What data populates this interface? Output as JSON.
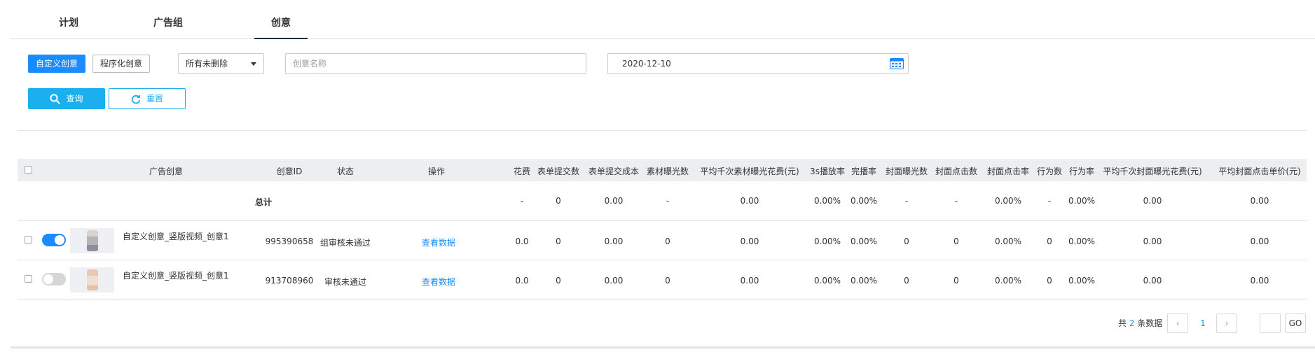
{
  "tabs": [
    "计划",
    "广告组",
    "创意"
  ],
  "filters": {
    "type_custom": "自定义创意",
    "type_program": "程序化创意",
    "status_select": "所有未删除",
    "name_placeholder": "创意名称",
    "date": "2020-12-10",
    "query": "查询",
    "reset": "重置"
  },
  "table": {
    "headers": [
      "广告创意",
      "创意ID",
      "状态",
      "操作",
      "花费",
      "表单提交数",
      "表单提交成本",
      "素材曝光数",
      "平均千次素材曝光花费(元)",
      "3s播放率",
      "完播率",
      "封面曝光数",
      "封面点击数",
      "封面点击率",
      "行为数",
      "行为率",
      "平均千次封面曝光花费(元)",
      "平均封面点击单价(元)"
    ],
    "total": {
      "label": "总计",
      "values": [
        "-",
        "0",
        "0.00",
        "-",
        "0.00",
        "0.00%",
        "0.00%",
        "-",
        "-",
        "0.00%",
        "-",
        "0.00%",
        "0.00",
        "0.00"
      ]
    },
    "rows": [
      {
        "enabled": true,
        "name": "自定义创意_竖版视频_创意1",
        "id": "995390658",
        "status": "组审核未通过",
        "action": "查看数据",
        "values": [
          "0.0",
          "0",
          "0.00",
          "0",
          "0.00",
          "0.00%",
          "0.00%",
          "0",
          "0",
          "0.00%",
          "0",
          "0.00%",
          "0.00",
          "0.00"
        ]
      },
      {
        "enabled": false,
        "name": "自定义创意_竖版视频_创意1",
        "id": "913708960",
        "status": "审核未通过",
        "action": "查看数据",
        "values": [
          "0.0",
          "0",
          "0.00",
          "0",
          "0.00",
          "0.00%",
          "0.00%",
          "0",
          "0",
          "0.00%",
          "0",
          "0.00%",
          "0.00",
          "0.00"
        ]
      }
    ]
  },
  "pagination": {
    "prefix": "共",
    "count": "2",
    "suffix": "条数据",
    "current_page": "1",
    "go": "GO",
    "prev_icon": "chevron-left-icon",
    "next_icon": "chevron-right-icon"
  },
  "colors": {
    "primary": "#1a8cff",
    "query_button": "#1ab0f0",
    "link": "#1a8cff"
  }
}
